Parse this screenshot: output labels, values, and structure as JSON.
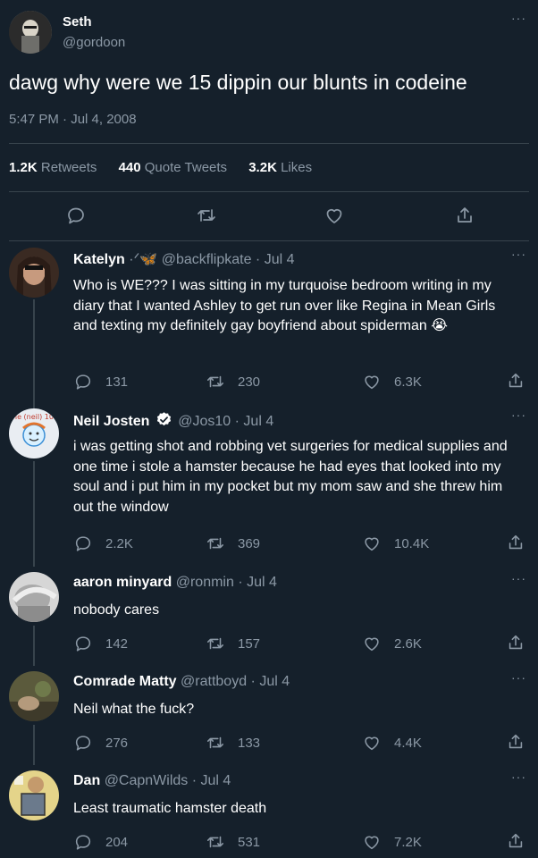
{
  "tweet": {
    "name": "Seth",
    "handle": "@gordoon",
    "text": "dawg why were we 15 dippin our blunts in codeine",
    "timestamp": "5:47 PM · Jul 4, 2008",
    "stats": {
      "retweets_count": "1.2K",
      "retweets_label": "Retweets",
      "quotes_count": "440",
      "quotes_label": "Quote Tweets",
      "likes_count": "3.2K",
      "likes_label": "Likes"
    }
  },
  "replies": [
    {
      "name": "Katelyn",
      "name_suffix": "·ᐟ🦋",
      "handle": "@backflipkate",
      "date": "· Jul 4",
      "text": "Who is WE??? I was sitting in my turquoise bedroom writing in my diary that I wanted Ashley to get run over like Regina in Mean Girls and texting my definitely gay boyfriend about spiderman 😭",
      "replies": "131",
      "retweets": "230",
      "likes": "6.3K"
    },
    {
      "name": "Neil Josten",
      "verified": true,
      "handle": "@Jos10",
      "date": "· Jul 4",
      "text": "i was getting shot and robbing vet surgeries for medical supplies and one time i stole a hamster because he had eyes that looked into my soul and i put him in my pocket but my mom saw and she threw him out the window",
      "replies": "2.2K",
      "retweets": "369",
      "likes": "10.4K",
      "avatar_text": "ne (neil) 10"
    },
    {
      "name": "aaron minyard",
      "handle": "@ronmin",
      "date": "· Jul 4",
      "text": "nobody cares",
      "replies": "142",
      "retweets": "157",
      "likes": "2.6K"
    },
    {
      "name": "Comrade Matty",
      "handle": "@rattboyd",
      "date": "· Jul 4",
      "text": "Neil what the fuck?",
      "replies": "276",
      "retweets": "133",
      "likes": "4.4K"
    },
    {
      "name": "Dan",
      "handle": "@CapnWilds",
      "date": "· Jul 4",
      "text": "Least traumatic hamster death",
      "replies": "204",
      "retweets": "531",
      "likes": "7.2K"
    }
  ],
  "more_glyph": "···",
  "icons": {
    "reply": "reply-icon",
    "retweet": "retweet-icon",
    "like": "heart-icon",
    "share": "share-icon",
    "verified": "verified-badge-icon"
  },
  "colors": {
    "background": "#15202b",
    "text": "#ffffff",
    "muted": "#8b98a5",
    "divider": "#38444d",
    "verified": "#ffffff"
  }
}
